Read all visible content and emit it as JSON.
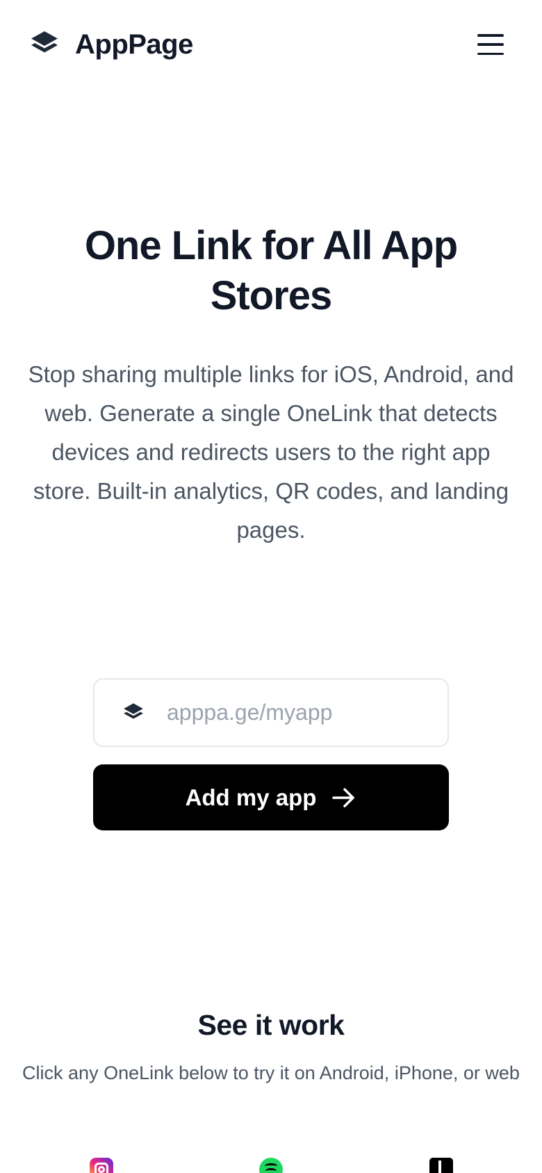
{
  "header": {
    "brand_name": "AppPage",
    "brand_icon": "layers-icon",
    "menu_icon": "hamburger-menu-icon"
  },
  "hero": {
    "title": "One Link for All App Stores",
    "description": "Stop sharing multiple links for iOS, Android, and web. Generate a single OneLink that detects devices and redirects users to the right app store. Built-in analytics, QR codes, and landing pages."
  },
  "form": {
    "url_placeholder": "apppa.ge/myapp",
    "url_value": "",
    "field_icon": "layers-icon",
    "submit_label": "Add my app",
    "submit_icon": "arrow-right-icon"
  },
  "demo": {
    "title": "See it work",
    "description": "Click any OneLink below to try it on Android, iPhone, or web",
    "apps": [
      {
        "icon": "instagram-icon"
      },
      {
        "icon": "spotify-icon"
      },
      {
        "icon": "tiktok-icon"
      }
    ]
  },
  "colors": {
    "text_primary": "#111827",
    "text_secondary": "#4b5563",
    "placeholder": "#9ca3af",
    "button_bg": "#000000",
    "input_border": "#e5e7eb"
  }
}
